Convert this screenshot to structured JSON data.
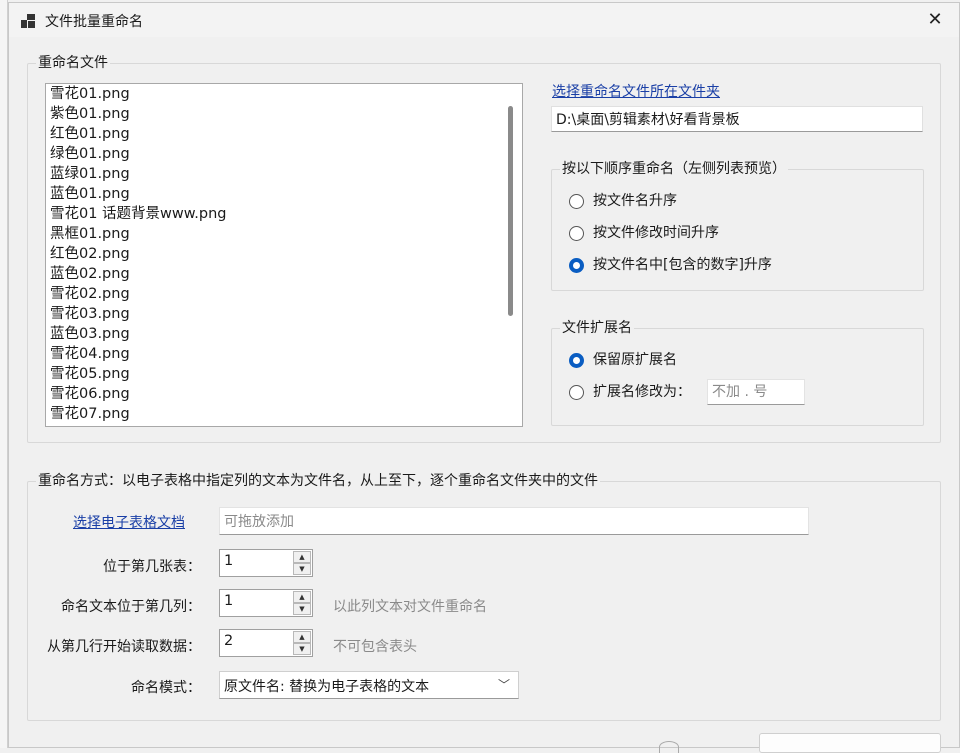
{
  "window": {
    "title": "文件批量重命名"
  },
  "file_group": {
    "label": "重命名文件",
    "files": [
      "雪花01.png",
      "紫色01.png",
      "红色01.png",
      "绿色01.png",
      "蓝绿01.png",
      "蓝色01.png",
      "雪花01 话题背景www.png",
      "黑框01.png",
      "红色02.png",
      "蓝色02.png",
      "雪花02.png",
      "雪花03.png",
      "蓝色03.png",
      "雪花04.png",
      "雪花05.png",
      "雪花06.png",
      "雪花07.png"
    ]
  },
  "folder": {
    "link_label": "选择重命名文件所在文件夹",
    "path": "D:\\桌面\\剪辑素材\\好看背景板"
  },
  "order_group": {
    "label": "按以下顺序重命名（左侧列表预览）",
    "options": [
      "按文件名升序",
      "按文件修改时间升序",
      "按文件名中[包含的数字]升序"
    ],
    "selected": "按文件名中[包含的数字]升序"
  },
  "ext_group": {
    "label": "文件扩展名",
    "keep_label": "保留原扩展名",
    "change_label": "扩展名修改为：",
    "ext_placeholder": "不加 . 号"
  },
  "method_group": {
    "label": "重命名方式：以电子表格中指定列的文本为文件名，从上至下，逐个重命名文件夹中的文件",
    "sheet_link": "选择电子表格文档",
    "sheet_placeholder": "可拖放添加",
    "sheet_label": "位于第几张表：",
    "sheet_value": "1",
    "col_label": "命名文本位于第几列：",
    "col_value": "1",
    "col_hint": "以此列文本对文件重命名",
    "row_label": "从第几行开始读取数据：",
    "row_value": "2",
    "row_hint": "不可包含表头",
    "mode_label": "命名模式：",
    "mode_value": "原文件名: 替换为电子表格的文本"
  },
  "icons": {
    "app": "app-icon",
    "close": "close-icon",
    "spin_up": "spin-up-icon",
    "spin_down": "spin-down-icon",
    "dropdown": "chevron-down-icon"
  },
  "colors": {
    "accent": "#0a5dc2",
    "link": "#1a3fa6",
    "background": "#f0f0f0"
  }
}
